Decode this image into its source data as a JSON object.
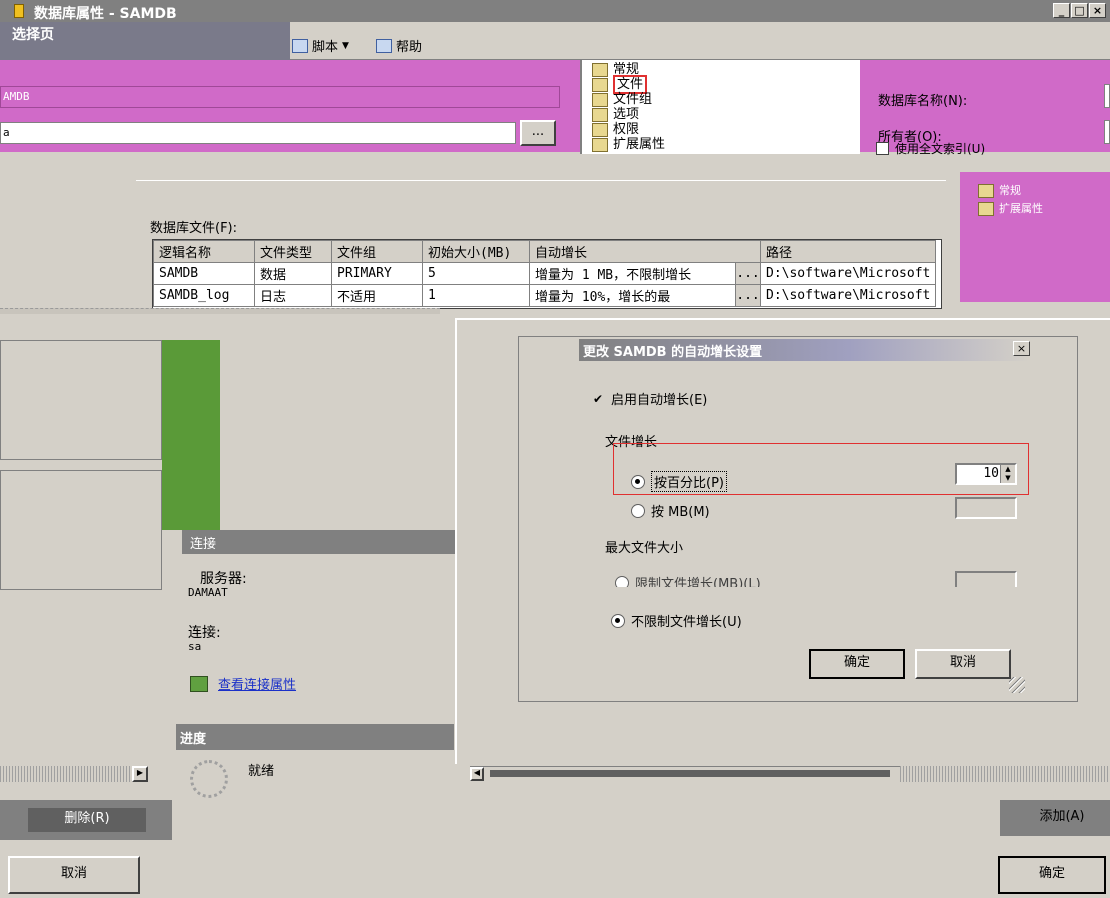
{
  "window": {
    "title": "数据库属性 - SAMDB",
    "controls": [
      "_",
      "□",
      "×"
    ]
  },
  "toolbar": {
    "select_page": "选择页",
    "script_label": "脚本",
    "help_label": "帮助"
  },
  "top_form": {
    "db_name_value": "AMDB",
    "owner_value": "a",
    "browse_label": "...",
    "db_name_label": "数据库名称(N):",
    "owner_label": "所有者(O):",
    "fulltext_label": "使用全文索引(U)"
  },
  "nav": {
    "items": [
      {
        "label": "常规"
      },
      {
        "label": "文件"
      },
      {
        "label": "文件组"
      },
      {
        "label": "选项"
      },
      {
        "label": "权限"
      },
      {
        "label": "扩展属性"
      }
    ],
    "mini_items": [
      {
        "label": "常规"
      },
      {
        "label": "扩展属性"
      }
    ]
  },
  "files_section": {
    "label": "数据库文件(F):",
    "columns": [
      "逻辑名称",
      "文件类型",
      "文件组",
      "初始大小(MB)",
      "自动增长",
      "路径"
    ],
    "rows": [
      {
        "name": "SAMDB",
        "type": "数据",
        "group": "PRIMARY",
        "size": "5",
        "growth": "增量为 1 MB，不限制增长",
        "browse": "...",
        "path": "D:\\software\\Microsoft"
      },
      {
        "name": "SAMDB_log",
        "type": "日志",
        "group": "不适用",
        "size": "1",
        "growth": "增量为 10%，增长的最",
        "browse": "...",
        "path": "D:\\software\\Microsoft"
      }
    ]
  },
  "connection": {
    "header": "连接",
    "server_label": "服务器:",
    "server_value": "DAMAAT",
    "connection_label": "连接:",
    "connection_value": "sa",
    "view_props_link": "查看连接属性"
  },
  "progress": {
    "header": "进度",
    "status": "就绪"
  },
  "bottom": {
    "remove_label": "删除(R)",
    "add_label": "添加(A)",
    "cancel_label": "取消",
    "ok_label": "确定"
  },
  "dialog": {
    "title": "更改 SAMDB 的自动增长设置",
    "close_label": "×",
    "enable_autogrowth": "启用自动增长(E)",
    "enable_checked": true,
    "file_growth_label": "文件增长",
    "percent_option": "按百分比(P)",
    "mb_option": "按 MB(M)",
    "percent_value": "10",
    "selected_growth": "percent",
    "max_size_label": "最大文件大小",
    "limit_option": "限制文件增长(MB)(L)",
    "unlimited_option": "不限制文件增长(U)",
    "selected_max": "unlimited",
    "ok_label": "确定",
    "cancel_label": "取消"
  }
}
